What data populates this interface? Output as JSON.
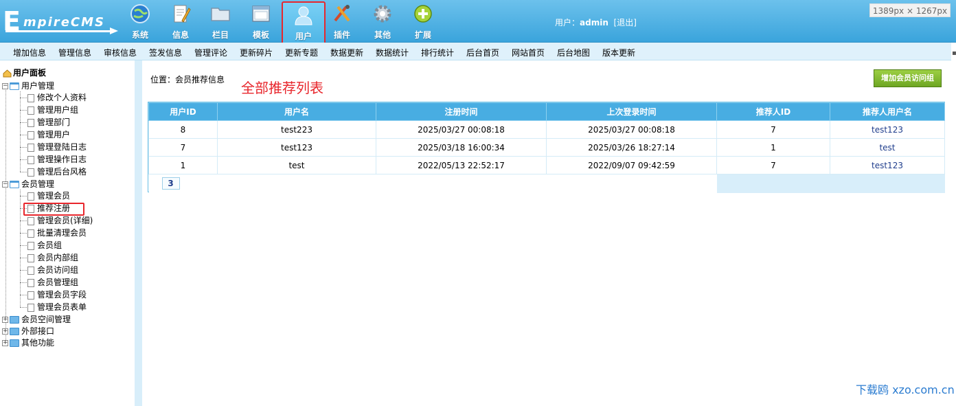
{
  "logo": {
    "initial": "E",
    "rest": "mpireCMS"
  },
  "topnav": [
    {
      "label": "系统",
      "icon": "globe-icon"
    },
    {
      "label": "信息",
      "icon": "document-edit-icon"
    },
    {
      "label": "栏目",
      "icon": "folder-icon"
    },
    {
      "label": "模板",
      "icon": "window-icon"
    },
    {
      "label": "用户",
      "icon": "user-icon"
    },
    {
      "label": "插件",
      "icon": "tools-icon"
    },
    {
      "label": "其他",
      "icon": "gear-icon"
    },
    {
      "label": "扩展",
      "icon": "plus-icon"
    }
  ],
  "user": {
    "prefix": "用户：",
    "name": "admin",
    "logout": "[退出]"
  },
  "size_badge": "1389px × 1267px",
  "subnav": [
    "增加信息",
    "管理信息",
    "审核信息",
    "签发信息",
    "管理评论",
    "更新碎片",
    "更新专题",
    "数据更新",
    "数据统计",
    "排行统计",
    "后台首页",
    "网站首页",
    "后台地图",
    "版本更新"
  ],
  "sidebar": {
    "title": "用户面板",
    "group1": {
      "label": "用户管理",
      "items": [
        "修改个人资料",
        "管理用户组",
        "管理部门",
        "管理用户",
        "管理登陆日志",
        "管理操作日志",
        "管理后台风格"
      ]
    },
    "group2": {
      "label": "会员管理",
      "items": [
        "管理会员",
        "推荐注册",
        "管理会员(详细)",
        "批量清理会员",
        "会员组",
        "会员内部组",
        "会员访问组",
        "会员管理组",
        "管理会员字段",
        "管理会员表单"
      ]
    },
    "group3": "会员空间管理",
    "group4": "外部接口",
    "group5": "其他功能"
  },
  "crumb": {
    "prefix": "位置：",
    "link": "会员推荐信息"
  },
  "big_title": "全部推荐列表",
  "add_button": "增加会员访问组",
  "table": {
    "headers": [
      "用户ID",
      "用户名",
      "注册时间",
      "上次登录时间",
      "推荐人ID",
      "推荐人用户名"
    ],
    "rows": [
      [
        "8",
        "test223",
        "2025/03/27 00:08:18",
        "2025/03/27 00:08:18",
        "7",
        "test123"
      ],
      [
        "7",
        "test123",
        "2025/03/18 16:00:34",
        "2025/03/26 18:27:14",
        "1",
        "test"
      ],
      [
        "1",
        "test",
        "2022/05/13 22:52:17",
        "2022/09/07 09:42:59",
        "7",
        "test123"
      ]
    ],
    "pager": "3"
  },
  "watermark": "下载鸥 xzo.com.cn",
  "colors": {
    "header": "#3aa4dc",
    "active_border": "#e8262c",
    "title_red": "#e8262c",
    "table_header": "#48ade2",
    "button_green": "#6ea623"
  }
}
